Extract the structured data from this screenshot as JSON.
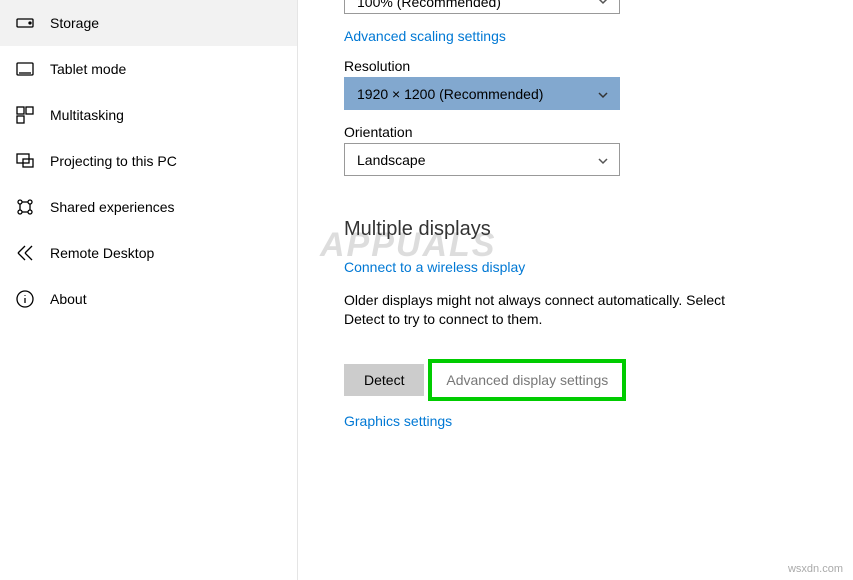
{
  "sidebar": {
    "items": [
      {
        "label": "Storage",
        "icon": "storage-icon"
      },
      {
        "label": "Tablet mode",
        "icon": "tablet-mode-icon"
      },
      {
        "label": "Multitasking",
        "icon": "multitasking-icon"
      },
      {
        "label": "Projecting to this PC",
        "icon": "projecting-icon"
      },
      {
        "label": "Shared experiences",
        "icon": "shared-experiences-icon"
      },
      {
        "label": "Remote Desktop",
        "icon": "remote-desktop-icon"
      },
      {
        "label": "About",
        "icon": "about-icon"
      }
    ]
  },
  "display": {
    "scale_value": "100% (Recommended)",
    "advanced_scaling_link": "Advanced scaling settings",
    "resolution_label": "Resolution",
    "resolution_value": "1920 × 1200 (Recommended)",
    "orientation_label": "Orientation",
    "orientation_value": "Landscape"
  },
  "multiple_displays": {
    "heading": "Multiple displays",
    "connect_link": "Connect to a wireless display",
    "older_text": "Older displays might not always connect automatically. Select Detect to try to connect to them.",
    "detect_button": "Detect",
    "advanced_display_link": "Advanced display settings",
    "graphics_link": "Graphics settings"
  },
  "watermark": "APPUALS",
  "attribution": "wsxdn.com"
}
